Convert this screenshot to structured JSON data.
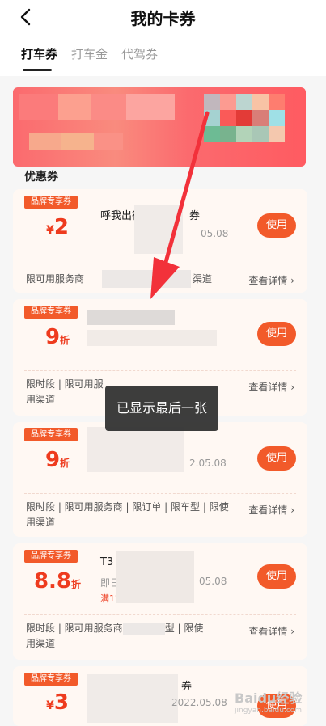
{
  "header": {
    "title": "我的卡券",
    "back_icon": "chevron-left-icon"
  },
  "tabs": [
    {
      "label": "打车券"
    },
    {
      "label": "打车金"
    },
    {
      "label": "代驾券"
    }
  ],
  "section_title": "优惠券",
  "coupons": [
    {
      "badge": "品牌专享券",
      "symbol": "¥",
      "amount": "2",
      "unit": "",
      "title": "呼我出行",
      "title_tail": "券",
      "date": "05.08",
      "restriction": "限可用服务商",
      "restriction_tail": "渠道",
      "detail": "查看详情",
      "use": "使用"
    },
    {
      "badge": "品牌专享券",
      "symbol": "",
      "amount": "9",
      "unit": "折",
      "title": "",
      "date": "",
      "restriction": "限时段 | 限可用服",
      "restriction_line2": "用渠道",
      "detail": "查看详情",
      "use": "使用"
    },
    {
      "badge": "品牌专享券",
      "symbol": "",
      "amount": "9",
      "unit": "折",
      "title": "",
      "date": "2.05.08",
      "restriction": "限时段 | 限可用服务商 | 限订单 | 限车型 | 限使",
      "restriction_line2": "用渠道",
      "detail": "查看详情",
      "use": "使用"
    },
    {
      "badge": "品牌专享券",
      "symbol": "",
      "amount": "8.8",
      "unit": "折",
      "title": "T3",
      "subtitle": "即日",
      "tag": "满12",
      "date": "05.08",
      "restriction": "限时段 | 限可用服务商",
      "restriction_tail": "型 | 限使",
      "restriction_line2": "用渠道",
      "detail": "查看详情",
      "use": "使用"
    },
    {
      "badge": "品牌专享券",
      "symbol": "¥",
      "amount": "3",
      "unit": "",
      "title": "",
      "title_tail": "券",
      "date": "2022.05.08",
      "use": "使用"
    }
  ],
  "toast": "已显示最后一张",
  "watermark": {
    "brand": "Baidu经验",
    "url": "jingyan.baidu.com"
  },
  "colors": {
    "accent": "#f25a2a",
    "value": "#ee3b1e",
    "card_bg": "#fff8f3",
    "arrow": "#f2313a"
  }
}
